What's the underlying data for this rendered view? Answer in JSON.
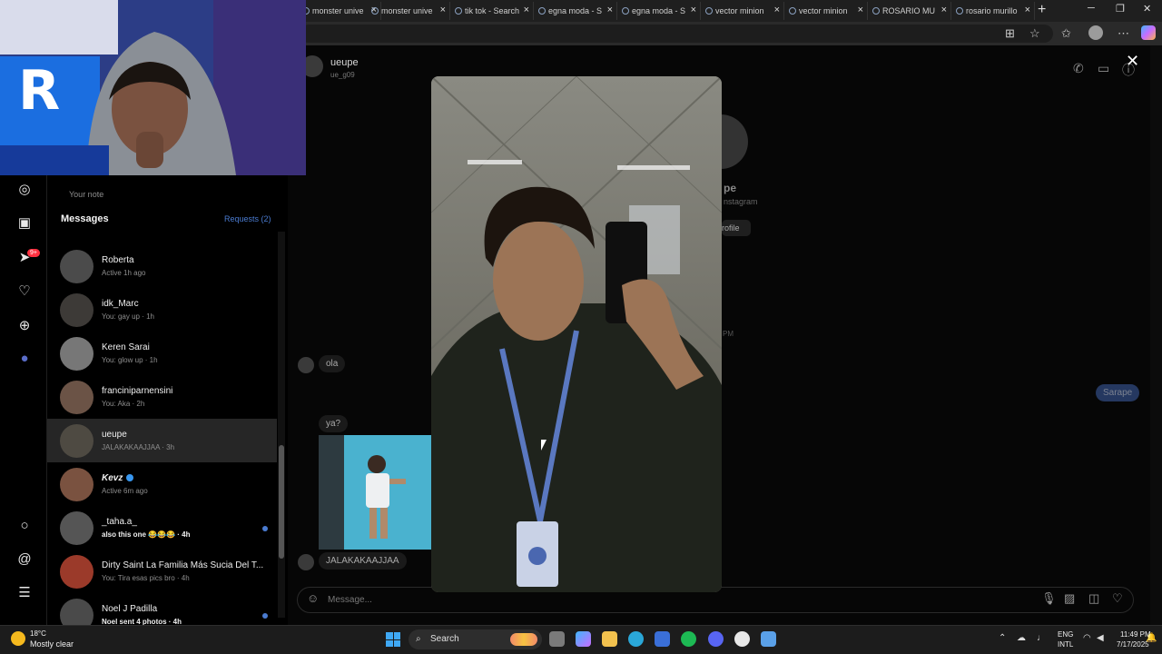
{
  "browser": {
    "tabs": [
      {
        "title": "monster unive"
      },
      {
        "title": "monster unive"
      },
      {
        "title": "tik tok - Search"
      },
      {
        "title": "egna moda - S"
      },
      {
        "title": "egna moda - S"
      },
      {
        "title": "vector minion"
      },
      {
        "title": "vector minion"
      },
      {
        "title": "ROSARIO MU"
      },
      {
        "title": "rosario murillo"
      }
    ],
    "new_tab": "+",
    "close_glyph": "×"
  },
  "sidebar": {
    "your_note": "Your note",
    "messages_header": "Messages",
    "requests_label": "Requests (2)",
    "notification_count": "9+"
  },
  "conversations": [
    {
      "name": "Roberta",
      "sub": "Active 1h ago",
      "unread": false,
      "bold": false
    },
    {
      "name": "idk_Marc",
      "sub": "You: gay up · 1h",
      "unread": false,
      "bold": false
    },
    {
      "name": "Keren Sarai",
      "sub": "You: glow up · 1h",
      "unread": false,
      "bold": false
    },
    {
      "name": "franciniparnensini",
      "sub": "You: Aka · 2h",
      "unread": false,
      "bold": false
    },
    {
      "name": "ueupe",
      "sub": "JALAKAKAAJJAA · 3h",
      "unread": false,
      "bold": false,
      "active": true
    },
    {
      "name": "Kevz",
      "sub": "Active 6m ago",
      "unread": false,
      "bold": false,
      "verified": true
    },
    {
      "name": "_taha.a_",
      "sub": "also this one 😂😂😂 · 4h",
      "unread": true,
      "bold": true
    },
    {
      "name": "Dirty Saint La Familia Más Sucia Del T...",
      "sub": "You: Tira esas pics bro · 4h",
      "unread": false,
      "bold": false
    },
    {
      "name": "Noel J Padilla",
      "sub": "Noel sent 4 photos · 4h",
      "unread": true,
      "bold": true
    }
  ],
  "chat": {
    "name": "ueupe",
    "handle": "ue_g09",
    "profile_name_partial": "pe",
    "profile_sub_partial": "nstagram",
    "profile_button_partial": "rofile",
    "time_partial": "PM",
    "messages": [
      {
        "text": "ola"
      },
      {
        "text": "ya?"
      },
      {
        "text": "JALAKAKAAJJAA"
      }
    ],
    "outgoing": "Sarape",
    "composer_placeholder": "Message..."
  },
  "taskbar": {
    "temperature": "18°C",
    "condition": "Mostly clear",
    "search_label": "Search",
    "lang_line1": "ENG",
    "lang_line2": "INTL",
    "time": "11:49 PM",
    "date": "7/17/2025"
  },
  "icons": {
    "rail": [
      "explore-icon",
      "reels-icon",
      "messenger-icon",
      "heart-icon",
      "create-icon",
      "profile-icon",
      "threads-circle-icon",
      "threads-icon",
      "menu-icon"
    ],
    "header": [
      "phone-icon",
      "video-icon",
      "info-icon"
    ],
    "composer": [
      "emoji-icon",
      "mic-icon",
      "image-icon",
      "sticker-icon",
      "heart-icon"
    ]
  },
  "colors": {
    "accent": "#4a7bd0",
    "outgoing_bubble": "#3a5a9c",
    "badge": "#ff3040"
  }
}
